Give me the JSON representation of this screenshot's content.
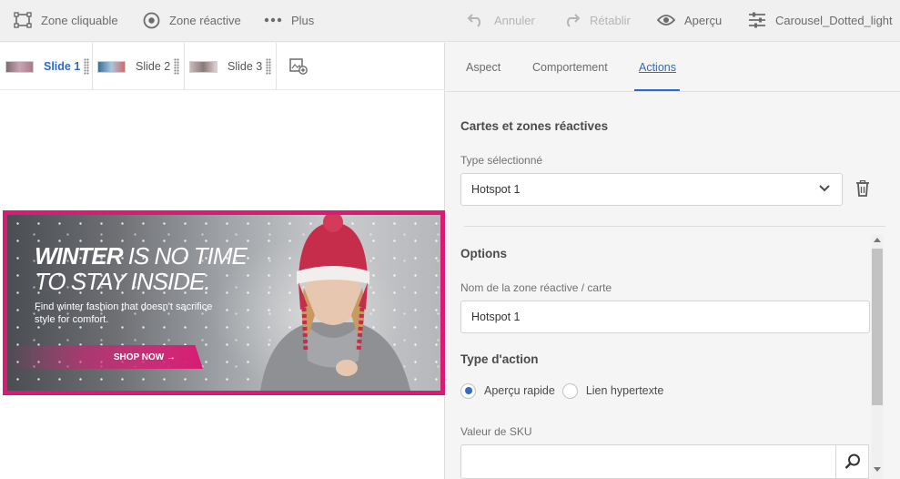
{
  "toolbar": {
    "zone_cliquable": "Zone cliquable",
    "zone_reactive": "Zone réactive",
    "plus": "Plus",
    "annuler": "Annuler",
    "retablir": "Rétablir",
    "apercu": "Aperçu",
    "preset_name": "Carousel_Dotted_light"
  },
  "slides": [
    {
      "label": "Slide 1",
      "active": true
    },
    {
      "label": "Slide 2",
      "active": false
    },
    {
      "label": "Slide 3",
      "active": false
    }
  ],
  "banner": {
    "headline_bold": "WINTER",
    "headline_rest": " IS NO TIME",
    "headline_line2": "TO STAY INSIDE.",
    "subtext": "Find winter fashion that doesn't sacrifice style for comfort.",
    "cta": "SHOP NOW →"
  },
  "tabs": [
    {
      "label": "Aspect",
      "active": false
    },
    {
      "label": "Comportement",
      "active": false
    },
    {
      "label": "Actions",
      "active": true
    }
  ],
  "panel": {
    "section_maps": "Cartes et zones réactives",
    "type_label": "Type sélectionné",
    "type_value": "Hotspot 1",
    "section_options": "Options",
    "name_label": "Nom de la zone réactive / carte",
    "name_value": "Hotspot 1",
    "action_type_title": "Type d'action",
    "radio_quick": "Aperçu rapide",
    "radio_link": "Lien hypertexte",
    "sku_label": "Valeur de SKU",
    "sku_value": ""
  },
  "colors": {
    "accent": "#2d6cc4",
    "banner_border": "#d81b74"
  }
}
